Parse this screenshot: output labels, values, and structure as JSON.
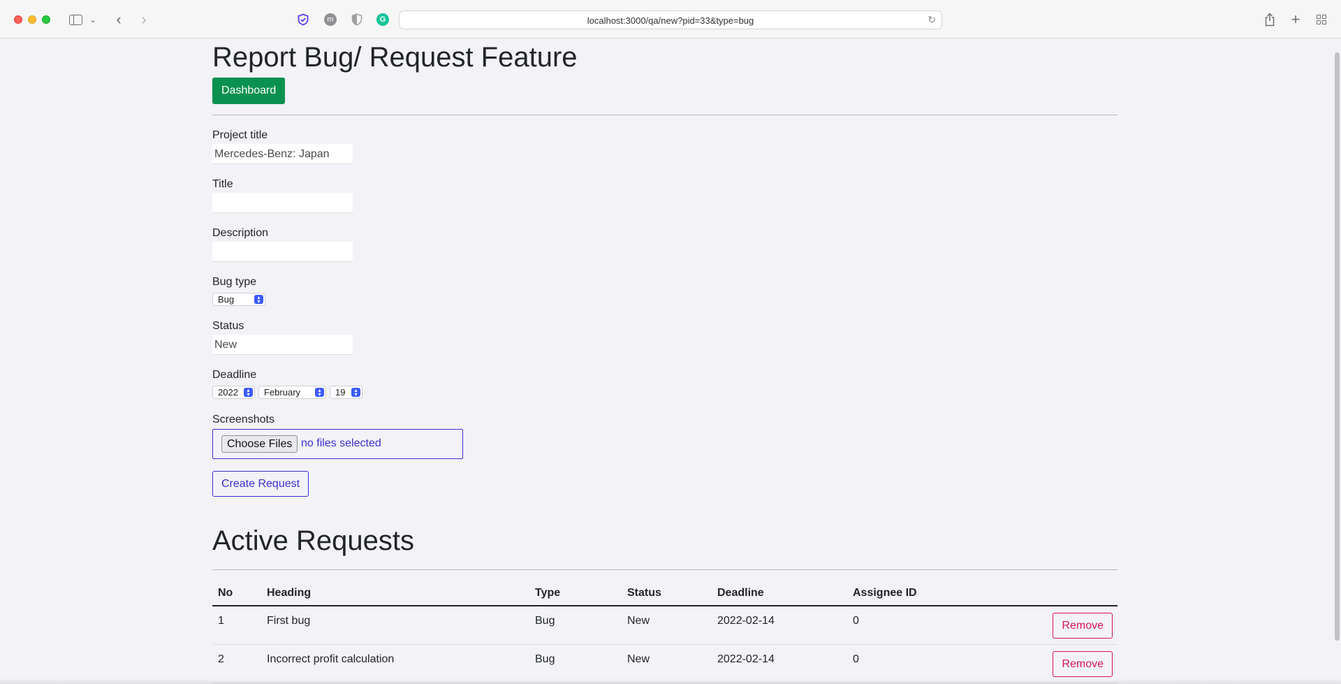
{
  "browser": {
    "url": "localhost:3000/qa/new?pid=33&type=bug",
    "ext_m_label": "m",
    "ext_g_label": "G"
  },
  "page": {
    "title": "Report Bug/ Request Feature",
    "dashboard_label": "Dashboard"
  },
  "form": {
    "project_title_label": "Project title",
    "project_title_value": "Mercedes-Benz: Japan",
    "title_label": "Title",
    "title_value": "",
    "description_label": "Description",
    "description_value": "",
    "bug_type_label": "Bug type",
    "bug_type_value": "Bug",
    "status_label": "Status",
    "status_value": "New",
    "deadline_label": "Deadline",
    "deadline_year": "2022",
    "deadline_month": "February",
    "deadline_day": "19",
    "screenshots_label": "Screenshots",
    "choose_files_label": "Choose Files",
    "file_status": "no files selected",
    "submit_label": "Create Request"
  },
  "requests": {
    "title": "Active Requests",
    "columns": [
      "No",
      "Heading",
      "Type",
      "Status",
      "Deadline",
      "Assignee ID"
    ],
    "remove_label": "Remove",
    "rows": [
      {
        "no": "1",
        "heading": "First bug",
        "type": "Bug",
        "status": "New",
        "deadline": "2022-02-14",
        "assignee": "0"
      },
      {
        "no": "2",
        "heading": "Incorrect profit calculation",
        "type": "Bug",
        "status": "New",
        "deadline": "2022-02-14",
        "assignee": "0"
      }
    ]
  },
  "colors": {
    "success": "#0a9150",
    "primary": "#3c2fd1",
    "danger": "#d6135a",
    "background": "#f2f2f7"
  }
}
